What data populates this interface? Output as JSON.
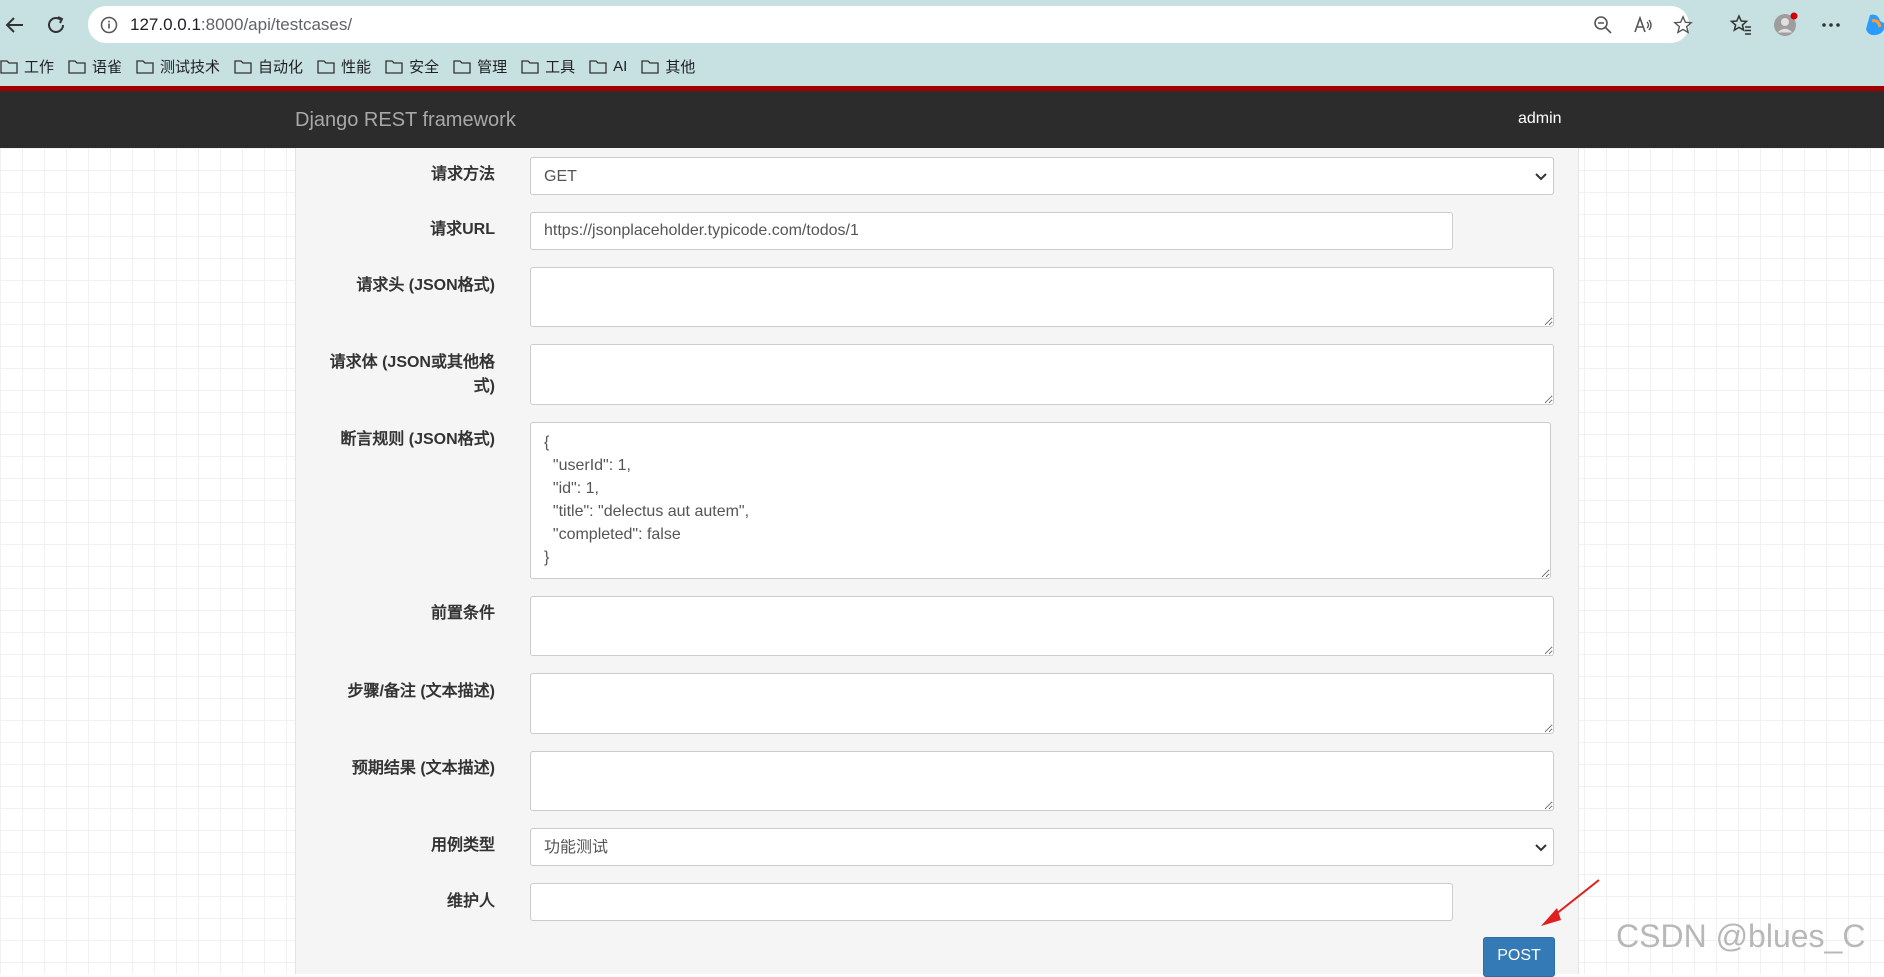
{
  "browser": {
    "url_host": "127.0.0.1",
    "url_path": ":8000/api/testcases/",
    "bookmarks": [
      "工作",
      "语雀",
      "测试技术",
      "自动化",
      "性能",
      "安全",
      "管理",
      "工具",
      "AI",
      "其他"
    ]
  },
  "header": {
    "brand": "Django REST framework",
    "user": "admin"
  },
  "form": {
    "method_label": "请求方法",
    "method_value": "GET",
    "url_label": "请求URL",
    "url_value": "https://jsonplaceholder.typicode.com/todos/1",
    "headers_label": "请求头 (JSON格式)",
    "headers_value": "",
    "body_label": "请求体 (JSON或其他格式)",
    "body_value": "",
    "assert_label": "断言规则 (JSON格式)",
    "assert_value": "{\n  \"userId\": 1,\n  \"id\": 1,\n  \"title\": \"delectus aut autem\",\n  \"completed\": false\n}",
    "precondition_label": "前置条件",
    "precondition_value": "",
    "steps_label": "步骤/备注 (文本描述)",
    "steps_value": "",
    "expected_label": "预期结果 (文本描述)",
    "expected_value": "",
    "type_label": "用例类型",
    "type_value": "功能测试",
    "maintainer_label": "维护人",
    "maintainer_value": "",
    "submit_label": "POST"
  },
  "watermark": "CSDN @blues_C",
  "colors": {
    "chrome_bg": "#c7e1e3",
    "header_bg": "#2c2c2c",
    "accent_red": "#a30000",
    "button_blue": "#337ab7"
  }
}
